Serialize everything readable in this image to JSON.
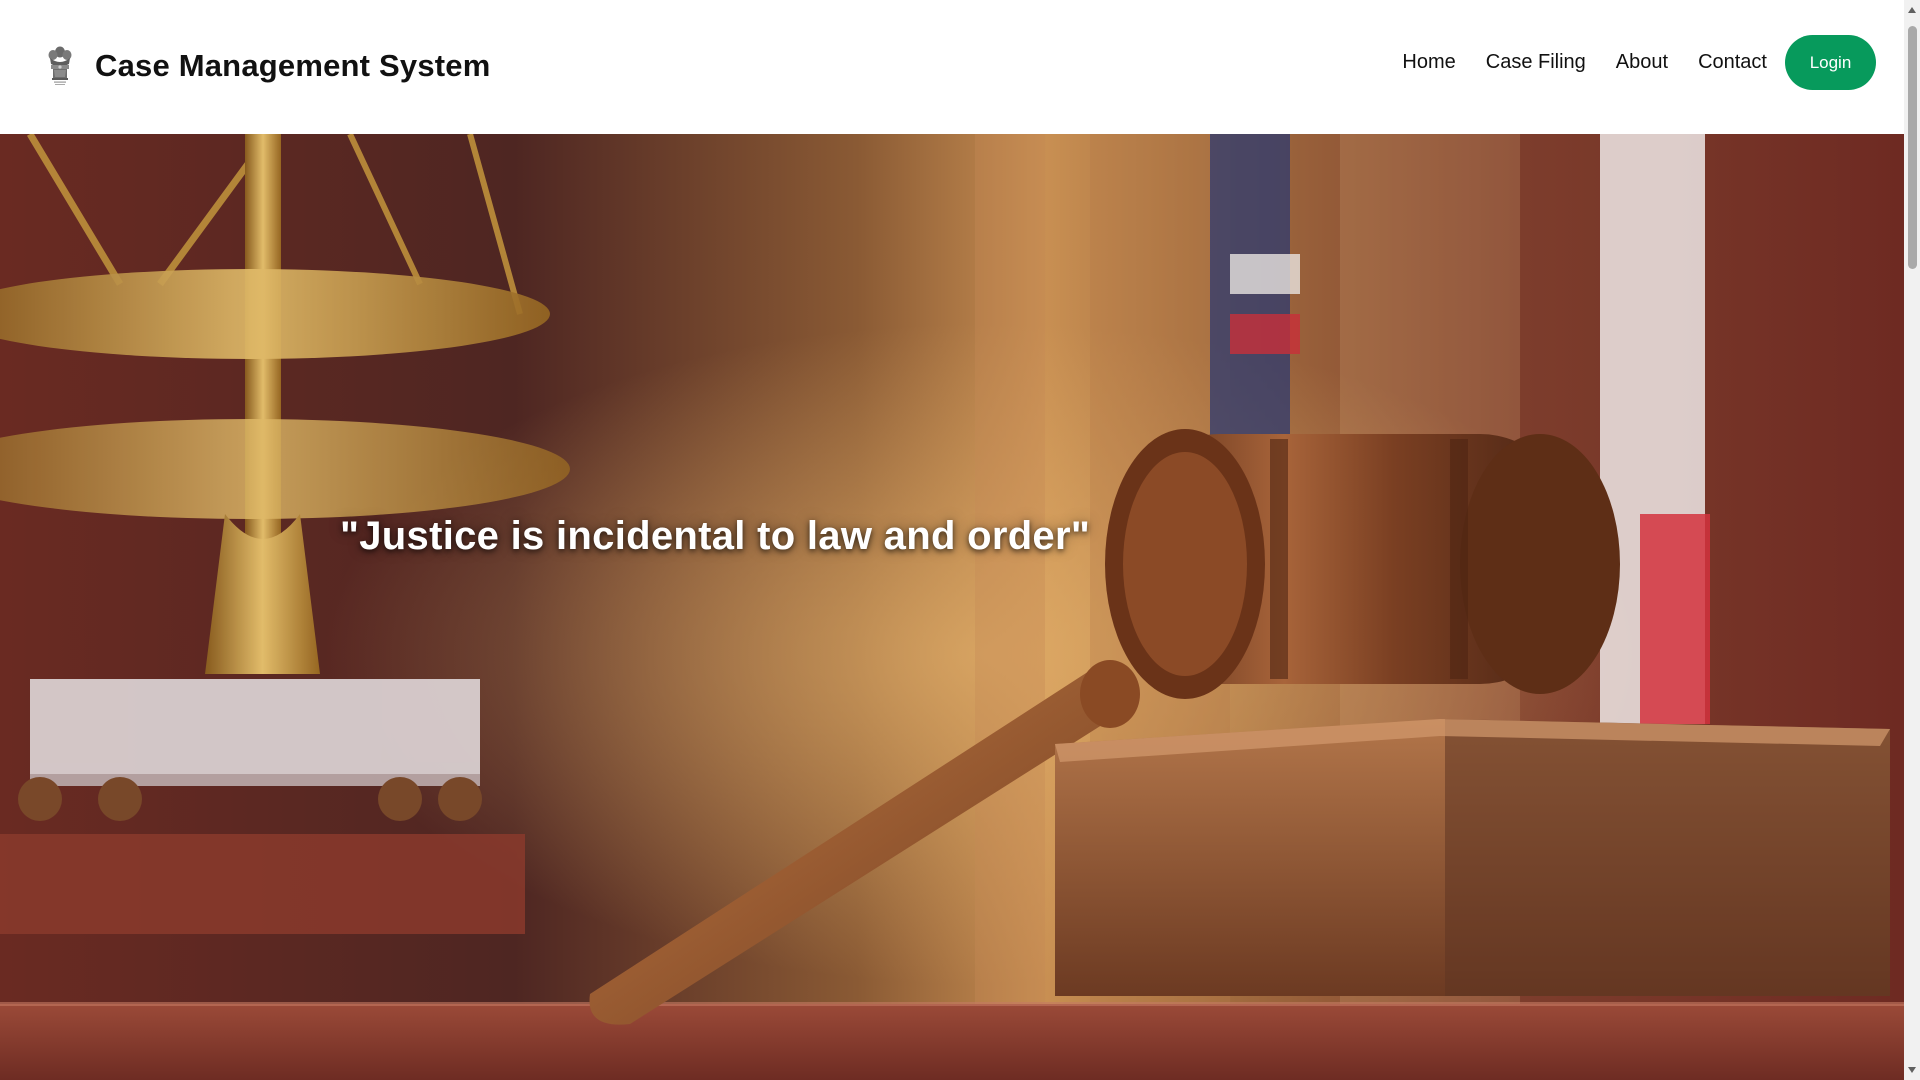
{
  "header": {
    "brand_title": "Case Management System",
    "logo_icon": "national-emblem-icon",
    "nav": [
      {
        "label": "Home"
      },
      {
        "label": "Case Filing"
      },
      {
        "label": "About"
      },
      {
        "label": "Contact"
      }
    ],
    "login_label": "Login"
  },
  "hero": {
    "quote": "\"Justice is incidental to law and order\"",
    "background_image": "courtroom-gavel-scales-photo"
  },
  "colors": {
    "accent": "#079a5c",
    "header_bg": "#ffffff",
    "title_text": "#111111"
  }
}
